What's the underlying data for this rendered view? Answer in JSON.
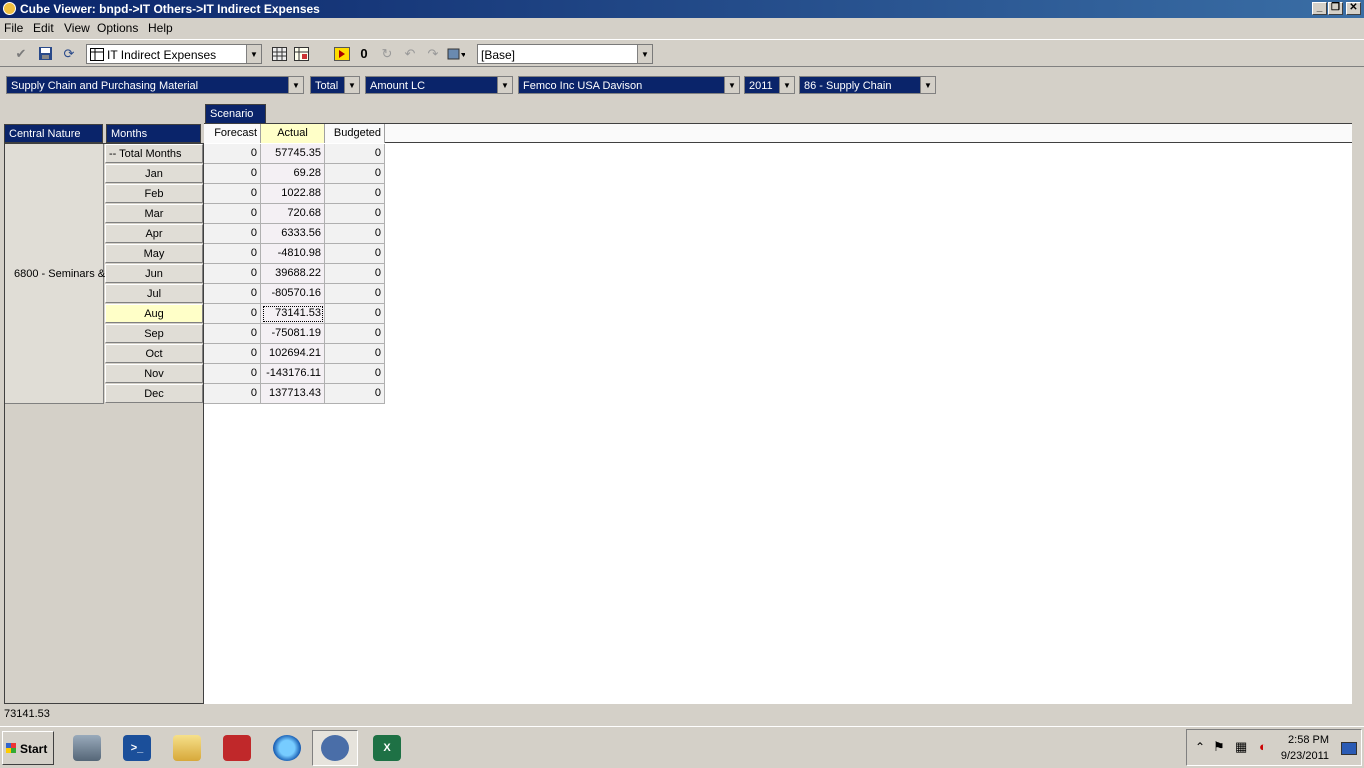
{
  "window": {
    "title": "Cube Viewer: bnpd->IT Others->IT Indirect Expenses"
  },
  "menu": [
    "File",
    "Edit",
    "View",
    "Options",
    "Help"
  ],
  "toolbar": {
    "cube_select": "IT Indirect Expenses",
    "view_select": "[Base]"
  },
  "dimensions": [
    {
      "name": "Supply Chain and Purchasing Material"
    },
    {
      "name": "Total"
    },
    {
      "name": "Amount LC"
    },
    {
      "name": "Femco Inc USA Davison"
    },
    {
      "name": "2011"
    },
    {
      "name": "86 - Supply Chain"
    }
  ],
  "grid": {
    "column_dimension": "Scenario",
    "row_dim_1": "Central Nature",
    "row_dim_2": "Months",
    "columns": [
      "Forecast",
      "Actual",
      "Budgeted"
    ],
    "row_group_label": "6800 - Seminars &",
    "rows": [
      {
        "label": "-- Total Months",
        "values": [
          "0",
          "57745.35",
          "0"
        ]
      },
      {
        "label": "Jan",
        "values": [
          "0",
          "69.28",
          "0"
        ]
      },
      {
        "label": "Feb",
        "values": [
          "0",
          "1022.88",
          "0"
        ]
      },
      {
        "label": "Mar",
        "values": [
          "0",
          "720.68",
          "0"
        ]
      },
      {
        "label": "Apr",
        "values": [
          "0",
          "6333.56",
          "0"
        ]
      },
      {
        "label": "May",
        "values": [
          "0",
          "-4810.98",
          "0"
        ]
      },
      {
        "label": "Jun",
        "values": [
          "0",
          "39688.22",
          "0"
        ]
      },
      {
        "label": "Jul",
        "values": [
          "0",
          "-80570.16",
          "0"
        ]
      },
      {
        "label": "Aug",
        "values": [
          "0",
          "73141.53",
          "0"
        ]
      },
      {
        "label": "Sep",
        "values": [
          "0",
          "-75081.19",
          "0"
        ]
      },
      {
        "label": "Oct",
        "values": [
          "0",
          "102694.21",
          "0"
        ]
      },
      {
        "label": "Nov",
        "values": [
          "0",
          "-143176.11",
          "0"
        ]
      },
      {
        "label": "Dec",
        "values": [
          "0",
          "137713.43",
          "0"
        ]
      }
    ],
    "selected_row": 8,
    "selected_column": 1
  },
  "status": {
    "value": "73141.53"
  },
  "taskbar": {
    "start_label": "Start",
    "clock_time": "2:58 PM",
    "clock_date": "9/23/2011"
  },
  "colors": {
    "title_bar": "#0a246a",
    "header_bg": "#0a246a",
    "highlight": "#ffffc8"
  }
}
